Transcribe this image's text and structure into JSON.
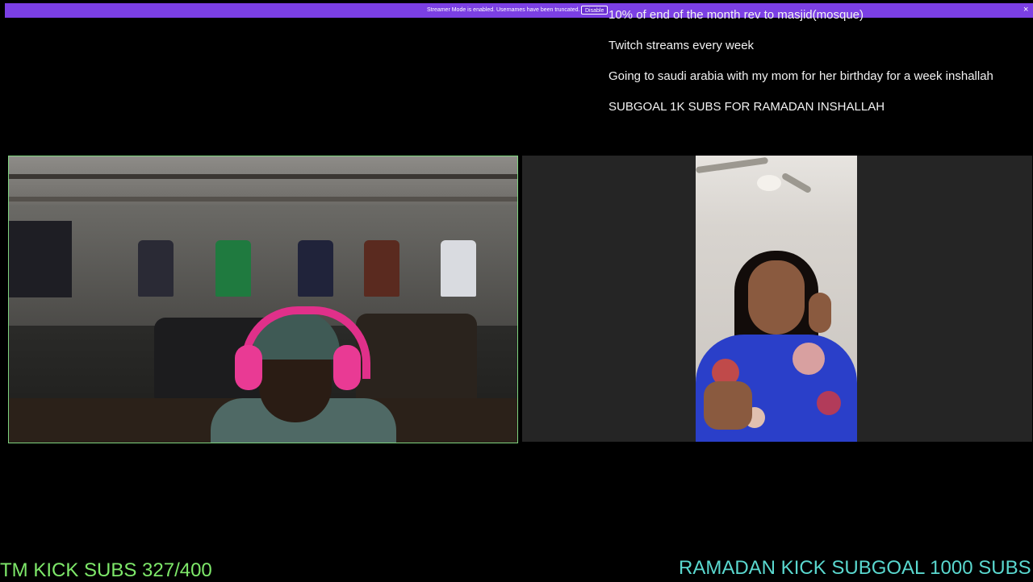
{
  "banner": {
    "message": "Streamer Mode is enabled. Usernames have been truncated.",
    "disable_label": "Disable",
    "close_glyph": "×",
    "color": "#7b3fe4"
  },
  "overlay_lines": [
    "10% of end of the month rev to masjid(mosque)",
    "Twitch streams every week",
    "Going to saudi arabia with my mom for her birthday for a week inshallah",
    "SUBGOAL 1K SUBS FOR RAMADAN INSHALLAH"
  ],
  "bottom": {
    "left_counter": "TM KICK SUBS 327/400",
    "right_goal": "RAMADAN KICK SUBGOAL 1000 SUBS",
    "left_color": "#7ee86a",
    "right_color": "#5ad8cf"
  },
  "icons": {
    "close": "close-icon"
  }
}
